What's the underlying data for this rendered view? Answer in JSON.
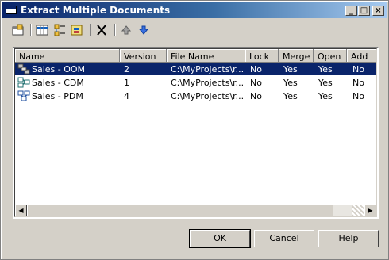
{
  "window": {
    "title": "Extract Multiple Documents"
  },
  "title_buttons": {
    "minimize": "_",
    "maximize": "□",
    "close": "×"
  },
  "toolbar": {
    "icons": [
      "properties-icon",
      "customize-columns-icon",
      "select-all-icon",
      "filter-icon",
      "delete-icon",
      "move-up-icon",
      "move-down-icon"
    ]
  },
  "list": {
    "columns": [
      "Name",
      "Version",
      "File Name",
      "Lock",
      "Merge",
      "Open",
      "Add"
    ],
    "rows": [
      {
        "icon": "oom-model-icon",
        "name": "Sales - OOM",
        "version": "2",
        "file": "C:\\MyProjects\\r...",
        "lock": "No",
        "merge": "Yes",
        "open": "Yes",
        "add": "No",
        "selected": true
      },
      {
        "icon": "cdm-model-icon",
        "name": "Sales - CDM",
        "version": "1",
        "file": "C:\\MyProjects\\r...",
        "lock": "No",
        "merge": "Yes",
        "open": "Yes",
        "add": "No",
        "selected": false
      },
      {
        "icon": "pdm-model-icon",
        "name": "Sales - PDM",
        "version": "4",
        "file": "C:\\MyProjects\\r...",
        "lock": "No",
        "merge": "Yes",
        "open": "Yes",
        "add": "No",
        "selected": false
      }
    ]
  },
  "buttons": {
    "ok": "OK",
    "cancel": "Cancel",
    "help": "Help"
  },
  "colors": {
    "selection": "#0a246a",
    "face": "#d4d0c8",
    "title_start": "#0a246a",
    "title_end": "#a6caf0"
  }
}
